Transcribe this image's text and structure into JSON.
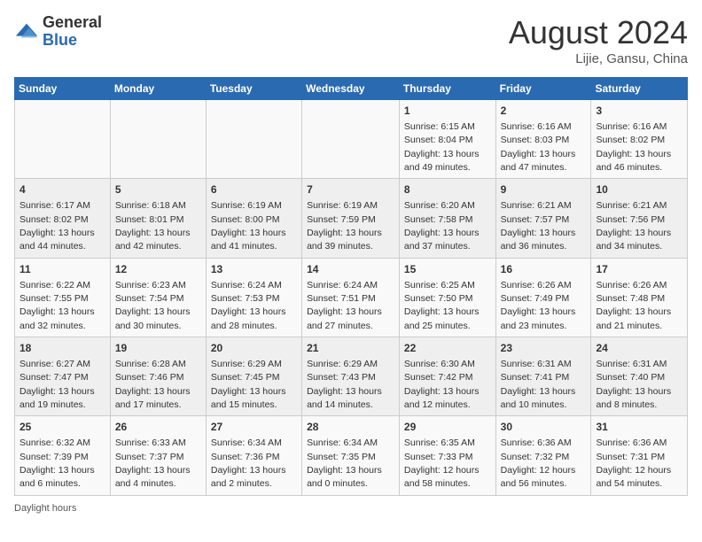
{
  "header": {
    "logo_general": "General",
    "logo_blue": "Blue",
    "month_title": "August 2024",
    "location": "Lijie, Gansu, China"
  },
  "weekdays": [
    "Sunday",
    "Monday",
    "Tuesday",
    "Wednesday",
    "Thursday",
    "Friday",
    "Saturday"
  ],
  "weeks": [
    [
      {
        "day": "",
        "info": ""
      },
      {
        "day": "",
        "info": ""
      },
      {
        "day": "",
        "info": ""
      },
      {
        "day": "",
        "info": ""
      },
      {
        "day": "1",
        "info": "Sunrise: 6:15 AM\nSunset: 8:04 PM\nDaylight: 13 hours and 49 minutes."
      },
      {
        "day": "2",
        "info": "Sunrise: 6:16 AM\nSunset: 8:03 PM\nDaylight: 13 hours and 47 minutes."
      },
      {
        "day": "3",
        "info": "Sunrise: 6:16 AM\nSunset: 8:02 PM\nDaylight: 13 hours and 46 minutes."
      }
    ],
    [
      {
        "day": "4",
        "info": "Sunrise: 6:17 AM\nSunset: 8:02 PM\nDaylight: 13 hours and 44 minutes."
      },
      {
        "day": "5",
        "info": "Sunrise: 6:18 AM\nSunset: 8:01 PM\nDaylight: 13 hours and 42 minutes."
      },
      {
        "day": "6",
        "info": "Sunrise: 6:19 AM\nSunset: 8:00 PM\nDaylight: 13 hours and 41 minutes."
      },
      {
        "day": "7",
        "info": "Sunrise: 6:19 AM\nSunset: 7:59 PM\nDaylight: 13 hours and 39 minutes."
      },
      {
        "day": "8",
        "info": "Sunrise: 6:20 AM\nSunset: 7:58 PM\nDaylight: 13 hours and 37 minutes."
      },
      {
        "day": "9",
        "info": "Sunrise: 6:21 AM\nSunset: 7:57 PM\nDaylight: 13 hours and 36 minutes."
      },
      {
        "day": "10",
        "info": "Sunrise: 6:21 AM\nSunset: 7:56 PM\nDaylight: 13 hours and 34 minutes."
      }
    ],
    [
      {
        "day": "11",
        "info": "Sunrise: 6:22 AM\nSunset: 7:55 PM\nDaylight: 13 hours and 32 minutes."
      },
      {
        "day": "12",
        "info": "Sunrise: 6:23 AM\nSunset: 7:54 PM\nDaylight: 13 hours and 30 minutes."
      },
      {
        "day": "13",
        "info": "Sunrise: 6:24 AM\nSunset: 7:53 PM\nDaylight: 13 hours and 28 minutes."
      },
      {
        "day": "14",
        "info": "Sunrise: 6:24 AM\nSunset: 7:51 PM\nDaylight: 13 hours and 27 minutes."
      },
      {
        "day": "15",
        "info": "Sunrise: 6:25 AM\nSunset: 7:50 PM\nDaylight: 13 hours and 25 minutes."
      },
      {
        "day": "16",
        "info": "Sunrise: 6:26 AM\nSunset: 7:49 PM\nDaylight: 13 hours and 23 minutes."
      },
      {
        "day": "17",
        "info": "Sunrise: 6:26 AM\nSunset: 7:48 PM\nDaylight: 13 hours and 21 minutes."
      }
    ],
    [
      {
        "day": "18",
        "info": "Sunrise: 6:27 AM\nSunset: 7:47 PM\nDaylight: 13 hours and 19 minutes."
      },
      {
        "day": "19",
        "info": "Sunrise: 6:28 AM\nSunset: 7:46 PM\nDaylight: 13 hours and 17 minutes."
      },
      {
        "day": "20",
        "info": "Sunrise: 6:29 AM\nSunset: 7:45 PM\nDaylight: 13 hours and 15 minutes."
      },
      {
        "day": "21",
        "info": "Sunrise: 6:29 AM\nSunset: 7:43 PM\nDaylight: 13 hours and 14 minutes."
      },
      {
        "day": "22",
        "info": "Sunrise: 6:30 AM\nSunset: 7:42 PM\nDaylight: 13 hours and 12 minutes."
      },
      {
        "day": "23",
        "info": "Sunrise: 6:31 AM\nSunset: 7:41 PM\nDaylight: 13 hours and 10 minutes."
      },
      {
        "day": "24",
        "info": "Sunrise: 6:31 AM\nSunset: 7:40 PM\nDaylight: 13 hours and 8 minutes."
      }
    ],
    [
      {
        "day": "25",
        "info": "Sunrise: 6:32 AM\nSunset: 7:39 PM\nDaylight: 13 hours and 6 minutes."
      },
      {
        "day": "26",
        "info": "Sunrise: 6:33 AM\nSunset: 7:37 PM\nDaylight: 13 hours and 4 minutes."
      },
      {
        "day": "27",
        "info": "Sunrise: 6:34 AM\nSunset: 7:36 PM\nDaylight: 13 hours and 2 minutes."
      },
      {
        "day": "28",
        "info": "Sunrise: 6:34 AM\nSunset: 7:35 PM\nDaylight: 13 hours and 0 minutes."
      },
      {
        "day": "29",
        "info": "Sunrise: 6:35 AM\nSunset: 7:33 PM\nDaylight: 12 hours and 58 minutes."
      },
      {
        "day": "30",
        "info": "Sunrise: 6:36 AM\nSunset: 7:32 PM\nDaylight: 12 hours and 56 minutes."
      },
      {
        "day": "31",
        "info": "Sunrise: 6:36 AM\nSunset: 7:31 PM\nDaylight: 12 hours and 54 minutes."
      }
    ]
  ],
  "footer": {
    "daylight_label": "Daylight hours"
  }
}
